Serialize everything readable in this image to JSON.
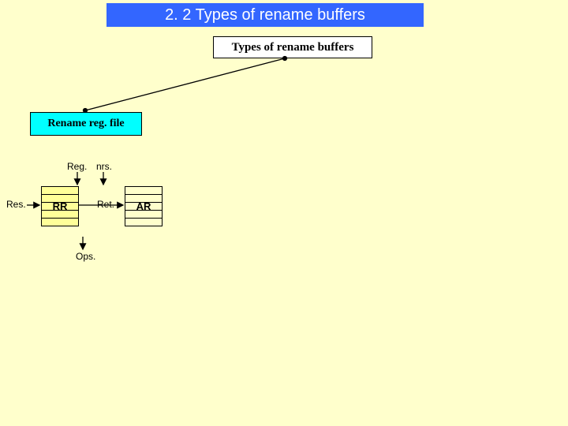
{
  "title": "2. 2 Types of rename buffers",
  "types_box": "Types of rename buffers",
  "rename_box": "Rename reg. file",
  "labels": {
    "reg": "Reg.",
    "nrs": "nrs.",
    "res": "Res.",
    "ret": "Ret.",
    "ops": "Ops."
  },
  "tables": {
    "rr": "RR",
    "ar": "AR"
  }
}
